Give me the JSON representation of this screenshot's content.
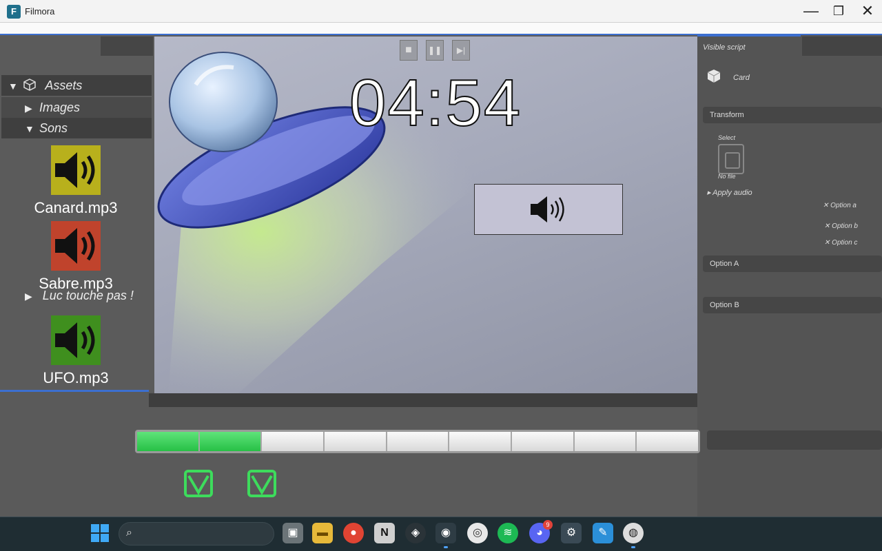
{
  "window": {
    "title": "Filmora",
    "app_icon_glyph": "F",
    "minimize": "—",
    "maximize": "❐",
    "close": "✕"
  },
  "left_panel": {
    "tree": [
      {
        "label": "Assets",
        "arrow": "▼"
      },
      {
        "label": "Images",
        "arrow": "▶"
      },
      {
        "label": "Sons",
        "arrow": "▼"
      }
    ],
    "sounds": [
      {
        "name": "Canard.mp3",
        "color": "#b8b01c"
      },
      {
        "name": "Sabre.mp3",
        "color": "#c0432c"
      },
      {
        "name": "UFO.mp3",
        "color": "#3f8f1e"
      }
    ],
    "subfolder": {
      "label": "Luc touche pas !",
      "arrow": "▶"
    }
  },
  "viewport": {
    "timer": "04:54",
    "transport": {
      "stop": "■",
      "pause": "❚❚",
      "step": "▶|"
    }
  },
  "right_panel": {
    "header": "Visible script",
    "component": "Card",
    "transform": "Transform",
    "box_label_top": "Select",
    "box_label_bottom": "No file",
    "subitem": "Apply audio",
    "options": [
      "Option a",
      "Option b",
      "Option c"
    ],
    "section_a": "Option A",
    "section_b": "Option B"
  },
  "progress": {
    "segments": 9,
    "completed": 2
  },
  "taskbar": {
    "search_icon": "search-icon",
    "apps": [
      "file-manager",
      "folder",
      "chrome",
      "notion",
      "unity",
      "app-a",
      "app-b",
      "spotify",
      "discord",
      "settings",
      "notes",
      "app-c"
    ],
    "discord_badge": "9"
  }
}
